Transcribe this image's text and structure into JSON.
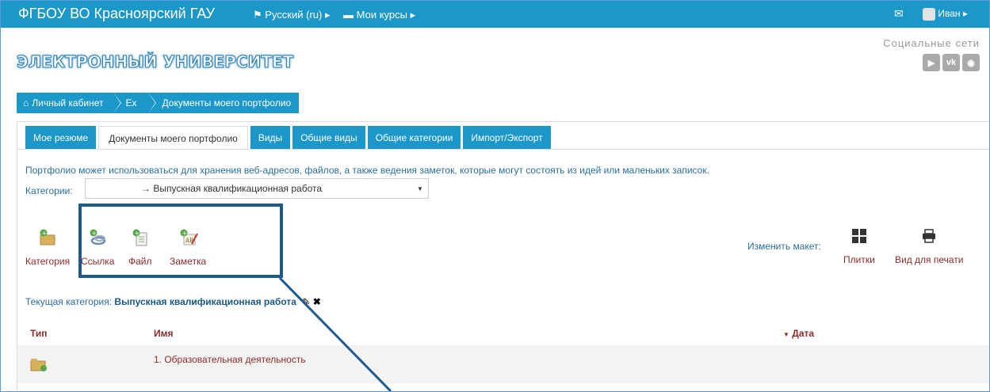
{
  "topbar": {
    "site_title": "ФГБОУ ВО Красноярский ГАУ",
    "language_menu": "Русский (ru)",
    "courses_menu": "Мои курсы",
    "user_menu": "Иван"
  },
  "header": {
    "logo_text": "ЭЛЕКТРОННЫЙ УНИВЕРСИТЕТ",
    "social_label": "Социальные сети",
    "social_icons": [
      "youtube-icon",
      "vk-icon",
      "globe-icon"
    ]
  },
  "breadcrumb": {
    "items": [
      "Личный кабинет",
      "Ex",
      "Документы моего портфолио"
    ]
  },
  "tabs": [
    {
      "label": "Мое резюме",
      "active": false
    },
    {
      "label": "Документы моего портфолио",
      "active": true
    },
    {
      "label": "Виды",
      "active": false
    },
    {
      "label": "Общие виды",
      "active": false
    },
    {
      "label": "Общие категории",
      "active": false
    },
    {
      "label": "Импорт/Экспорт",
      "active": false
    }
  ],
  "main": {
    "description": "Портфолио может использоваться для хранения веб-адресов, файлов, а также ведения заметок, которые могут состоять из идей или маленьких записок.",
    "category_label": "Категории:",
    "category_selected": "→ Выпускная квалификационная работа",
    "toolbar": {
      "category": "Категория",
      "link": "Ссылка",
      "file": "Файл",
      "note": "Заметка"
    },
    "layout_label": "Изменить макет:",
    "tiles": "Плитки",
    "print_view": "Вид для печати",
    "current_label": "Текущая категория:",
    "current_value": "Выпускная квалификационная работа"
  },
  "table": {
    "headers": {
      "type": "Тип",
      "name": "Имя",
      "date": "Дата"
    },
    "rows": [
      {
        "name": "1. Образовательная деятельность"
      }
    ]
  },
  "colors": {
    "accent": "#1b98c9",
    "link": "#8b2b2b",
    "annotation": "#1f5a8e"
  }
}
